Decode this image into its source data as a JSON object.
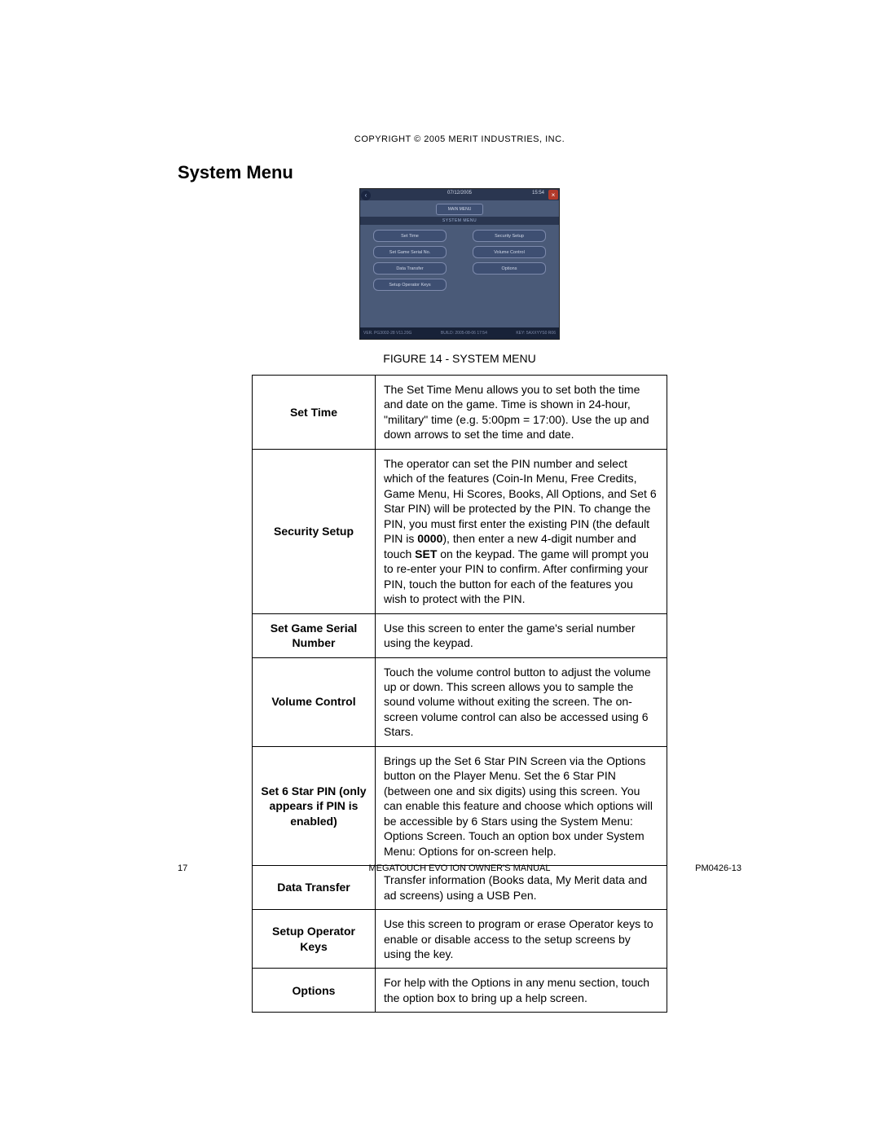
{
  "copyright": "COPYRIGHT © 2005 MERIT INDUSTRIES, INC.",
  "title": "System Menu",
  "figure": {
    "date": "07/12/2005",
    "time": "15:54",
    "main_menu": "MAIN MENU",
    "section": "SYSTEM MENU",
    "buttons": {
      "b1": "Set Time",
      "b2": "Security Setup",
      "b3": "Set Game Serial No.",
      "b4": "Volume Control",
      "b5": "Data Transfer",
      "b6": "Options",
      "b7": "Setup Operator Keys"
    },
    "foot_left": "VER.  PG3002-28 V11.20G",
    "foot_mid": "BUILD:  2005-08-06  17:54",
    "foot_right": "KEY:  5AXXYYS0 R06"
  },
  "caption": "FIGURE 14 - SYSTEM MENU",
  "rows": [
    {
      "label": "Set Time",
      "text": "The Set Time Menu allows you to set both the time and date on the game.  Time is shown in 24-hour, \"military\" time (e.g. 5:00pm = 17:00).  Use the up and down arrows to set the time and date."
    },
    {
      "label": "Security Setup",
      "text": "The operator can set the PIN number and select which of the features (Coin-In Menu, Free Credits, Game Menu, Hi Scores, Books, All Options, and Set 6 Star PIN) will be protected by the PIN.  To change the PIN, you must first enter the existing PIN (the default PIN is 0000), then enter a new 4-digit number and touch SET on the keypad.  The game will prompt you to re-enter your PIN to confirm.  After confirming your PIN, touch the button for each of the features you wish to protect with the PIN."
    },
    {
      "label": "Set Game Serial Number",
      "text": "Use this screen to enter the game's serial number using the keypad."
    },
    {
      "label": "Volume Control",
      "text": "Touch the volume control button to adjust the volume up or down.  This screen allows you to sample the sound volume without exiting the screen.  The on-screen volume control can also be accessed using 6 Stars."
    },
    {
      "label": "Set 6 Star PIN (only appears if PIN is enabled)",
      "text": "Brings up the Set 6 Star PIN Screen via the Options button on the Player Menu. Set the 6 Star PIN (between one and six digits) using this screen.  You can enable this feature and choose which options will be accessible by 6 Stars using the System Menu: Options Screen.  Touch an option box under System Menu: Options for on-screen help."
    },
    {
      "label": "Data Transfer",
      "text": "Transfer information (Books data, My Merit data and ad screens) using a USB Pen."
    },
    {
      "label": "Setup Operator Keys",
      "text": "Use this screen to program or erase Operator keys to enable or disable access to the setup screens by using the key."
    },
    {
      "label": "Options",
      "text": "For help with the Options in any menu section, touch the option box to bring up a help screen."
    }
  ],
  "footer": {
    "page": "17",
    "center": "MEGATOUCH EVO ION  OWNER'S MANUAL",
    "right": "PM0426-13"
  }
}
